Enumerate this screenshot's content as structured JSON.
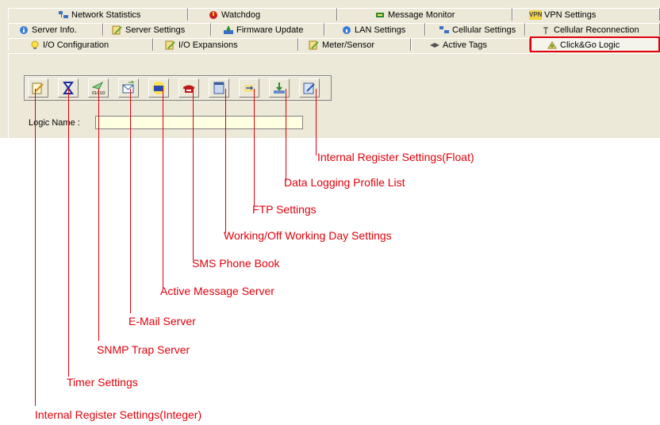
{
  "tabs": {
    "row1": [
      {
        "label": "Network Statistics",
        "icon": "network-stats-icon"
      },
      {
        "label": "Watchdog",
        "icon": "watchdog-icon"
      },
      {
        "label": "Message Monitor",
        "icon": "message-monitor-icon"
      },
      {
        "label": "VPN Settings",
        "icon": "vpn-icon",
        "icon_text": "VPN"
      }
    ],
    "row2": [
      {
        "label": "Server Info.",
        "icon": "info-icon"
      },
      {
        "label": "Server Settings",
        "icon": "server-settings-icon"
      },
      {
        "label": "Firmware Update",
        "icon": "firmware-icon"
      },
      {
        "label": "LAN Settings",
        "icon": "lan-icon"
      },
      {
        "label": "Cellular Settings",
        "icon": "cellular-icon"
      },
      {
        "label": "Cellular Reconnection",
        "icon": "antenna-icon"
      }
    ],
    "row3": [
      {
        "label": "I/O Configuration",
        "icon": "bulb-icon"
      },
      {
        "label": "I/O Expansions",
        "icon": "expansion-icon"
      },
      {
        "label": "Meter/Sensor",
        "icon": "meter-icon"
      },
      {
        "label": "Active Tags",
        "icon": "tags-icon"
      },
      {
        "label": "Click&Go Logic",
        "icon": "logic-icon",
        "selected": true
      }
    ]
  },
  "toolbar_buttons": [
    {
      "name": "internal-register-integer",
      "icon": "edit-icon"
    },
    {
      "name": "timer-settings",
      "icon": "hourglass-icon"
    },
    {
      "name": "snmp-trap-server",
      "icon": "snmp-icon",
      "icon_text": "010101"
    },
    {
      "name": "email-server",
      "icon": "email-icon"
    },
    {
      "name": "active-message-server",
      "icon": "active-message-icon"
    },
    {
      "name": "sms-phone-book",
      "icon": "phone-icon"
    },
    {
      "name": "working-day-settings",
      "icon": "calendar-icon"
    },
    {
      "name": "ftp-settings",
      "icon": "ftp-icon"
    },
    {
      "name": "data-logging-profile-list",
      "icon": "data-logging-icon"
    },
    {
      "name": "internal-register-float",
      "icon": "float-register-icon"
    }
  ],
  "logic_name": {
    "label": "Logic Name :",
    "value": ""
  },
  "callouts": [
    "Internal Register Settings(Integer)",
    "Timer Settings",
    "SNMP Trap Server",
    "E-Mail Server",
    "Active Message Server",
    "SMS Phone Book",
    "Working/Off Working Day Settings",
    "FTP Settings",
    "Data Logging Profile List",
    "Internal Register Settings(Float)"
  ],
  "colors": {
    "annotation": "#e0000a",
    "window": "#ece9d8",
    "field": "#ffffe1"
  }
}
